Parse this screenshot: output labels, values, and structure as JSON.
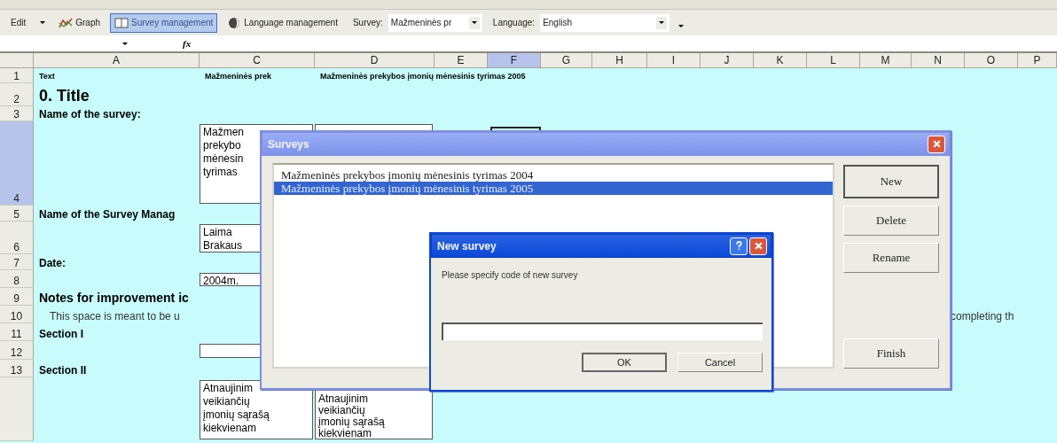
{
  "toolbar": {
    "menu": "Edit",
    "buttons": [
      {
        "label": "Graph",
        "selected": false
      },
      {
        "label": "Survey management",
        "selected": true
      },
      {
        "label": "Language management",
        "selected": false
      }
    ],
    "combos": [
      {
        "label": "Survey:",
        "value": "Mažmeninės pr"
      },
      {
        "label": "Language:",
        "value": "English"
      }
    ]
  },
  "formula_bar": {
    "function_label": "fx"
  },
  "sheet": {
    "columns": [
      {
        "label": "A",
        "selected": false
      },
      {
        "label": "C",
        "selected": false
      },
      {
        "label": "D",
        "selected": false
      },
      {
        "label": "E",
        "selected": false
      },
      {
        "label": "F",
        "selected": true
      },
      {
        "label": "G",
        "selected": false
      },
      {
        "label": "H",
        "selected": false
      },
      {
        "label": "I",
        "selected": false
      },
      {
        "label": "J",
        "selected": false
      },
      {
        "label": "K",
        "selected": false
      },
      {
        "label": "L",
        "selected": false
      },
      {
        "label": "M",
        "selected": false
      },
      {
        "label": "N",
        "selected": false
      },
      {
        "label": "O",
        "selected": false
      },
      {
        "label": "P",
        "selected": false
      }
    ],
    "rows": [
      {
        "number": "1",
        "selected": false,
        "cells": [
          {
            "kind": "label",
            "text": "Text"
          },
          {
            "kind": "label",
            "text": "Mažmeninės prek"
          },
          {
            "kind": "label",
            "text": "Mažmeninės prekybos įmonių mėnesinis tyrimas 2005"
          }
        ]
      },
      {
        "number": "2",
        "selected": false,
        "cells": [
          {
            "kind": "title",
            "text": "0. Title"
          }
        ]
      },
      {
        "number": "3",
        "selected": false,
        "cells": [
          {
            "kind": "heading",
            "text": "Name of the survey:"
          }
        ]
      },
      {
        "number": "4",
        "selected": true,
        "cells": [
          {
            "kind": "boxed",
            "lines": [
              "Mažmen",
              "prekybo",
              "mėnesin",
              "tyrimas"
            ]
          },
          {
            "kind": "boxed"
          },
          {
            "kind": "framed"
          }
        ]
      },
      {
        "number": "5",
        "selected": false,
        "cells": [
          {
            "kind": "heading",
            "text": "Name of the Survey Manag"
          }
        ]
      },
      {
        "number": "6",
        "selected": false,
        "cells": [
          {
            "kind": "boxed",
            "lines": [
              "Laima",
              "Brakaus"
            ]
          }
        ]
      },
      {
        "number": "7",
        "selected": false,
        "cells": [
          {
            "kind": "heading",
            "text": "Date:"
          }
        ]
      },
      {
        "number": "8",
        "selected": false,
        "cells": [
          {
            "kind": "boxed",
            "lines": [
              "2004m."
            ]
          }
        ]
      },
      {
        "number": "9",
        "selected": false,
        "cells": [
          {
            "kind": "section",
            "text": "Notes for improvement ic"
          }
        ]
      },
      {
        "number": "10",
        "selected": false,
        "cells": [
          {
            "kind": "note",
            "text": "This space is meant to be u"
          }
        ],
        "overflow_text": "completing th"
      },
      {
        "number": "11",
        "selected": false,
        "cells": [
          {
            "kind": "heading",
            "text": "Section I"
          }
        ]
      },
      {
        "number": "12",
        "selected": false,
        "cells": [
          {
            "kind": "boxed"
          }
        ]
      },
      {
        "number": "13",
        "selected": false,
        "cells": [
          {
            "kind": "heading",
            "text": "Section II"
          }
        ]
      },
      {
        "number": "",
        "selected": false,
        "cells": [
          {
            "kind": "empty",
            "text": ""
          },
          {
            "kind": "boxed",
            "lines": [
              "Atnaujinim",
              "veikiančių",
              "įmonių sąrašą",
              "kiekvienam"
            ]
          },
          {
            "kind": "boxed",
            "lines": [
              "Atnaujinim",
              "veikiančių",
              "įmonių sąrašą",
              "kiekvienam"
            ]
          }
        ]
      }
    ]
  },
  "surveys_dialog": {
    "title": "Surveys",
    "active": false,
    "items": [
      {
        "label": "Mažmeninės prekybos įmonių mėnesinis tyrimas 2004",
        "selected": false
      },
      {
        "label": "Mažmeninės prekybos įmonių mėnesinis tyrimas 2005",
        "selected": true
      }
    ],
    "buttons": [
      {
        "label": "New",
        "default": true
      },
      {
        "label": "Delete",
        "default": false
      },
      {
        "label": "Rename",
        "default": false
      },
      {
        "label": "Finish",
        "default": false
      }
    ]
  },
  "new_survey_dialog": {
    "title": "New survey",
    "active": true,
    "prompt": "Please specify code of new survey",
    "buttons": [
      {
        "label": "OK",
        "default": true
      },
      {
        "label": "Cancel",
        "default": false
      }
    ]
  }
}
